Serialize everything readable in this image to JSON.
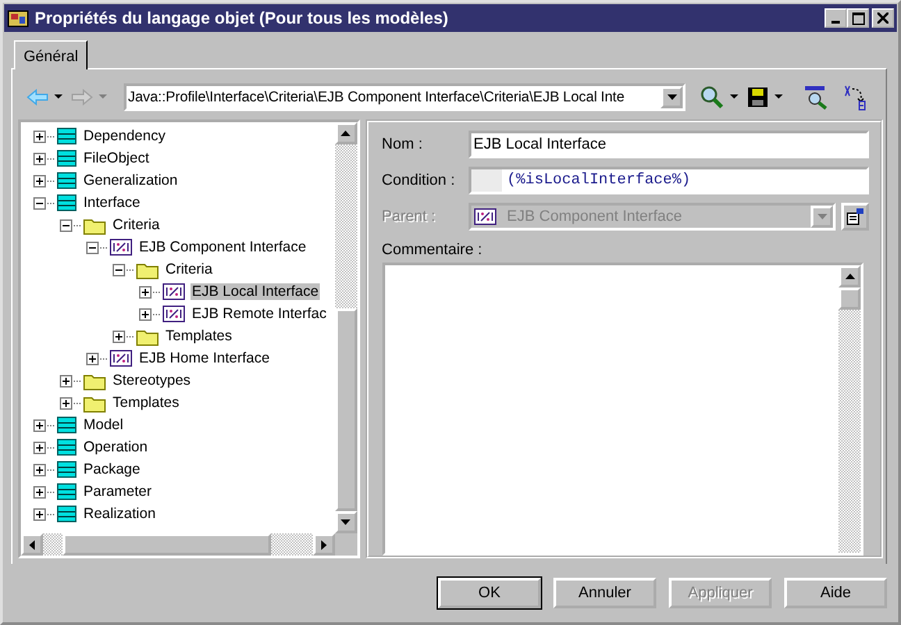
{
  "window": {
    "title": "Propriétés du langage objet (Pour tous les modèles)"
  },
  "tabs": [
    {
      "label": "Général",
      "selected": true
    }
  ],
  "toolbar": {
    "path": "Java::Profile\\Interface\\Criteria\\EJB Component Interface\\Criteria\\EJB Local Inte",
    "back_disabled": false,
    "forward_disabled": true
  },
  "tree": [
    {
      "label": "Dependency",
      "kind": "metaclass",
      "expanded": false,
      "selected": false
    },
    {
      "label": "FileObject",
      "kind": "metaclass",
      "expanded": false,
      "selected": false
    },
    {
      "label": "Generalization",
      "kind": "metaclass",
      "expanded": false,
      "selected": false
    },
    {
      "label": "Interface",
      "kind": "metaclass",
      "expanded": true,
      "selected": false,
      "children": [
        {
          "label": "Criteria",
          "kind": "folder",
          "expanded": true,
          "selected": false,
          "children": [
            {
              "label": "EJB Component Interface",
              "kind": "criterion",
              "expanded": true,
              "selected": false,
              "children": [
                {
                  "label": "Criteria",
                  "kind": "folder",
                  "expanded": true,
                  "selected": false,
                  "children": [
                    {
                      "label": "EJB Local Interface",
                      "kind": "criterion",
                      "expanded": false,
                      "selected": true
                    },
                    {
                      "label": "EJB Remote Interfac",
                      "kind": "criterion",
                      "expanded": false,
                      "selected": false
                    }
                  ]
                },
                {
                  "label": "Templates",
                  "kind": "folder",
                  "expanded": false,
                  "selected": false
                }
              ]
            },
            {
              "label": "EJB Home Interface",
              "kind": "criterion",
              "expanded": false,
              "selected": false
            }
          ]
        },
        {
          "label": "Stereotypes",
          "kind": "folder",
          "expanded": false,
          "selected": false
        },
        {
          "label": "Templates",
          "kind": "folder",
          "expanded": false,
          "selected": false
        }
      ]
    },
    {
      "label": "Model",
      "kind": "metaclass",
      "expanded": false,
      "selected": false
    },
    {
      "label": "Operation",
      "kind": "metaclass",
      "expanded": false,
      "selected": false
    },
    {
      "label": "Package",
      "kind": "metaclass",
      "expanded": false,
      "selected": false
    },
    {
      "label": "Parameter",
      "kind": "metaclass",
      "expanded": false,
      "selected": false
    },
    {
      "label": "Realization",
      "kind": "metaclass",
      "expanded": false,
      "selected": false
    }
  ],
  "form": {
    "name_label": "Nom :",
    "name_value": "EJB Local Interface",
    "condition_label": "Condition :",
    "condition_value": "(%isLocalInterface%)",
    "parent_label": "Parent :",
    "parent_value": "EJB Component Interface",
    "parent_disabled": true,
    "comment_label": "Commentaire :"
  },
  "buttons": [
    {
      "label": "OK",
      "disabled": false,
      "default": true
    },
    {
      "label": "Annuler",
      "disabled": false,
      "default": false
    },
    {
      "label": "Appliquer",
      "disabled": true,
      "default": false
    },
    {
      "label": "Aide",
      "disabled": false,
      "default": false
    }
  ]
}
